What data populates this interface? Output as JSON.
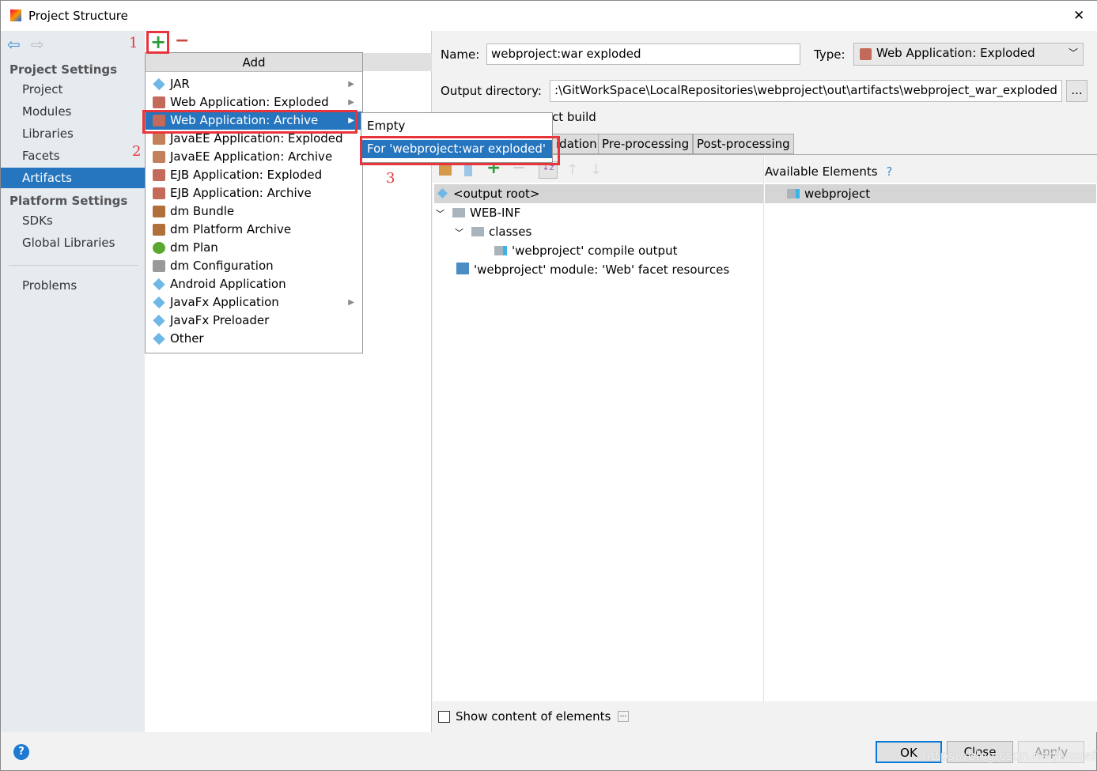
{
  "window": {
    "title": "Project Structure",
    "close": "✕"
  },
  "sidebar": {
    "project_settings": "Project Settings",
    "items": [
      "Project",
      "Modules",
      "Libraries",
      "Facets",
      "Artifacts"
    ],
    "platform_settings": "Platform Settings",
    "platform_items": [
      "SDKs",
      "Global Libraries"
    ],
    "problems": "Problems",
    "selected": "Artifacts"
  },
  "toolbar": {
    "add": "+",
    "remove": "−"
  },
  "add_menu": {
    "header": "Add",
    "items": [
      {
        "label": "JAR",
        "icon": "jar-icon",
        "submenu": true
      },
      {
        "label": "Web Application: Exploded",
        "icon": "web-app-icon",
        "submenu": true
      },
      {
        "label": "Web Application: Archive",
        "icon": "web-app-icon",
        "submenu": true,
        "selected": true
      },
      {
        "label": "JavaEE Application: Exploded",
        "icon": "javaee-icon"
      },
      {
        "label": "JavaEE Application: Archive",
        "icon": "javaee-icon"
      },
      {
        "label": "EJB Application: Exploded",
        "icon": "ejb-icon"
      },
      {
        "label": "EJB Application: Archive",
        "icon": "ejb-icon"
      },
      {
        "label": "dm Bundle",
        "icon": "dm-bundle-icon"
      },
      {
        "label": "dm Platform Archive",
        "icon": "dm-bundle-icon"
      },
      {
        "label": "dm Plan",
        "icon": "dm-plan-icon"
      },
      {
        "label": "dm Configuration",
        "icon": "dm-config-icon"
      },
      {
        "label": "Android Application",
        "icon": "jar-icon"
      },
      {
        "label": "JavaFx Application",
        "icon": "jar-icon",
        "submenu": true
      },
      {
        "label": "JavaFx Preloader",
        "icon": "jar-icon"
      },
      {
        "label": "Other",
        "icon": "jar-icon"
      }
    ]
  },
  "submenu": {
    "items": [
      "Empty",
      "For 'webproject:war exploded'"
    ],
    "selected": 1
  },
  "annotations": [
    "1",
    "2",
    "3"
  ],
  "form": {
    "name_label": "Name:",
    "name_value": "webproject:war exploded",
    "type_label": "Type:",
    "type_value": "Web Application: Exploded",
    "output_label": "Output directory:",
    "output_value": ":\\GitWorkSpace\\LocalRepositories\\webproject\\out\\artifacts\\webproject_war_exploded",
    "browse": "...",
    "build_partial": "ct build"
  },
  "tabs": [
    "idation",
    "Pre-processing",
    "Post-processing"
  ],
  "layout_tree": [
    {
      "label": "<output root>",
      "icon": "output-root-icon",
      "depth": 0,
      "selected": true
    },
    {
      "label": "WEB-INF",
      "icon": "folder-icon",
      "depth": 0,
      "expanded": true
    },
    {
      "label": "classes",
      "icon": "folder-icon",
      "depth": 1,
      "expanded": true
    },
    {
      "label": "'webproject' compile output",
      "icon": "module-output-icon",
      "depth": 2
    },
    {
      "label": "'webproject' module: 'Web' facet resources",
      "icon": "web-facet-icon",
      "depth": 0
    }
  ],
  "available": {
    "title": "Available Elements",
    "help": "?",
    "items": [
      "webproject"
    ]
  },
  "show_content": {
    "label": "Show content of elements",
    "checked": false,
    "more": "..."
  },
  "buttons": {
    "ok": "OK",
    "close": "Close",
    "apply": "Apply",
    "help": "?"
  },
  "watermark": "https://blog.csdn.net/lyxuefeng",
  "colors": {
    "selection": "#2675bf",
    "annotation": "#e8343a"
  }
}
